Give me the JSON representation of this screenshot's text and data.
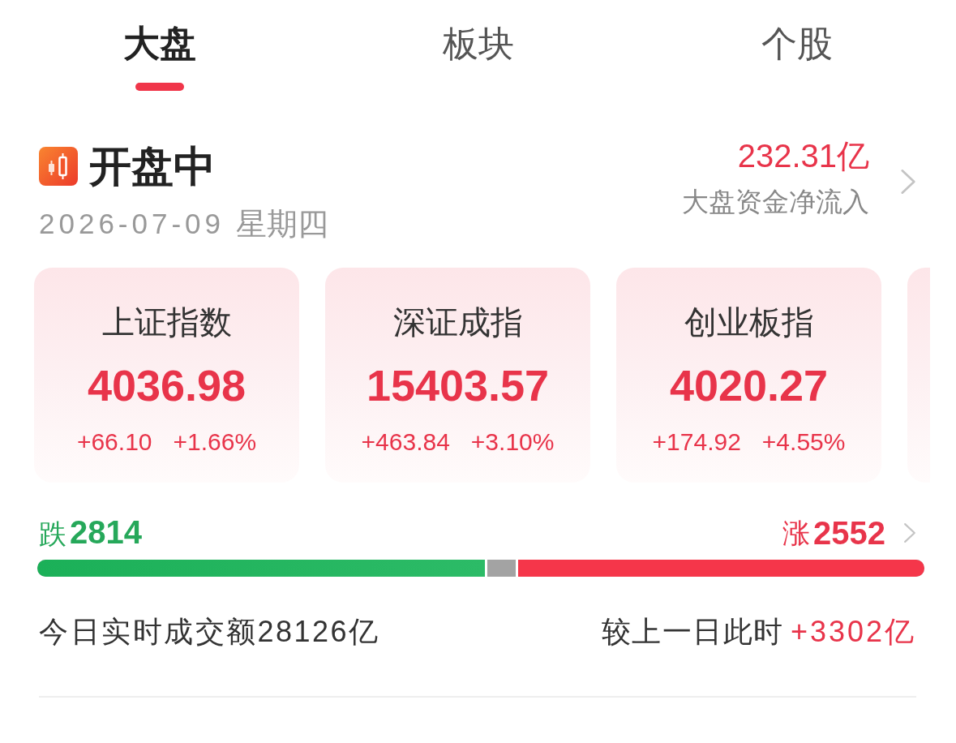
{
  "tabs": [
    {
      "label": "大盘",
      "selected": true
    },
    {
      "label": "板块",
      "selected": false
    },
    {
      "label": "个股",
      "selected": false
    }
  ],
  "market_status": {
    "title": "开盘中",
    "date": "2026-07-09",
    "weekday": "星期四"
  },
  "net_inflow": {
    "value": "232.31亿",
    "label": "大盘资金净流入"
  },
  "index_cards": [
    {
      "name": "上证指数",
      "value": "4036.98",
      "change": "+66.10",
      "change_pct": "+1.66%"
    },
    {
      "name": "深证成指",
      "value": "15403.57",
      "change": "+463.84",
      "change_pct": "+3.10%"
    },
    {
      "name": "创业板指",
      "value": "4020.27",
      "change": "+174.92",
      "change_pct": "+4.55%"
    }
  ],
  "breadth": {
    "fall_label": "跌",
    "fall_count": "2814",
    "rise_label": "涨",
    "rise_count": "2552",
    "fills": [
      {
        "kind": "fall",
        "level": 0.507
      },
      {
        "kind": "rise",
        "level": 0.461
      }
    ]
  },
  "turnover": {
    "label": "今日实时成交额28126亿",
    "compare_label": "较上一日此时",
    "compare_value": "+3302亿"
  }
}
